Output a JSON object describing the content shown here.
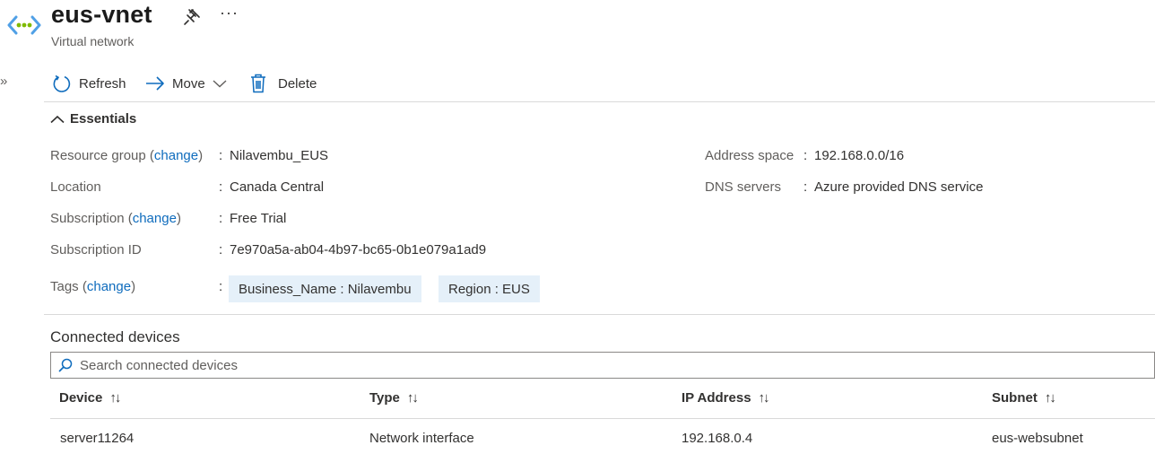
{
  "header": {
    "title": "eus-vnet",
    "subtitle": "Virtual network",
    "more_label": "···",
    "expand_label": "»"
  },
  "toolbar": {
    "refresh_label": "Refresh",
    "move_label": "Move",
    "delete_label": "Delete"
  },
  "essentials": {
    "heading": "Essentials",
    "change_link": "change",
    "left": {
      "resource_group_label": "Resource group",
      "resource_group_value": "Nilavembu_EUS",
      "location_label": "Location",
      "location_value": "Canada Central",
      "subscription_label": "Subscription",
      "subscription_value": "Free Trial",
      "subscription_id_label": "Subscription ID",
      "subscription_id_value": "7e970a5a-ab04-4b97-bc65-0b1e079a1ad9",
      "tags_label": "Tags",
      "tags": [
        "Business_Name : Nilavembu",
        "Region : EUS"
      ]
    },
    "right": {
      "address_space_label": "Address space",
      "address_space_value": "192.168.0.0/16",
      "dns_servers_label": "DNS servers",
      "dns_servers_value": "Azure provided DNS service"
    }
  },
  "connected_devices": {
    "title": "Connected devices",
    "search_placeholder": "Search connected devices",
    "columns": [
      "Device",
      "Type",
      "IP Address",
      "Subnet"
    ],
    "sort_glyph": "↑↓",
    "rows": [
      {
        "device": "server11264",
        "type": "Network interface",
        "ip": "192.168.0.4",
        "subnet": "eus-websubnet"
      }
    ]
  },
  "colors": {
    "accent": "#0f6cbd",
    "tag_background": "#e5f0f9"
  }
}
